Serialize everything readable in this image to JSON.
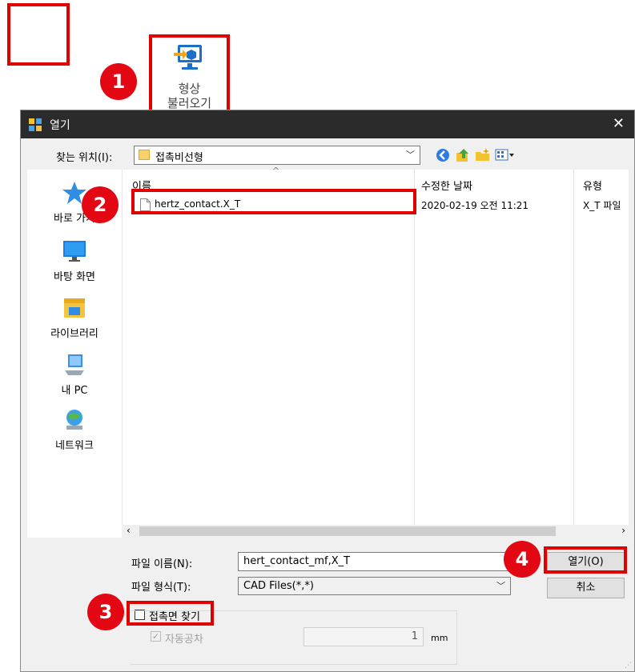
{
  "toolbar": {
    "shape_import_label_line1": "형상",
    "shape_import_label_line2": "불러오기",
    "shape_import_icon": "monitor-import-icon"
  },
  "steps": {
    "s1": "1",
    "s2": "2",
    "s3": "3",
    "s4": "4"
  },
  "dialog": {
    "title": "열기",
    "close_glyph": "✕",
    "look_in_label": "찾는 위치(I):",
    "look_in_value": "접촉비선형",
    "nav_icons": [
      "back-icon",
      "up-folder-icon",
      "new-folder-icon",
      "view-menu-icon"
    ],
    "places": [
      {
        "label": "바로 가기",
        "icon": "star-icon"
      },
      {
        "label": "바탕 화면",
        "icon": "desktop-icon"
      },
      {
        "label": "라이브러리",
        "icon": "library-icon"
      },
      {
        "label": "내 PC",
        "icon": "computer-icon"
      },
      {
        "label": "네트워크",
        "icon": "network-icon"
      }
    ],
    "columns": {
      "name": "이름",
      "date": "수정한 날짜",
      "type": "유형"
    },
    "files": [
      {
        "name": "hertz_contact.X_T",
        "date": "2020-02-19 오전 11:21",
        "type": "X_T 파일"
      }
    ],
    "filename_label": "파일 이름(N):",
    "filename_value": "hert_contact_mf,X_T",
    "filetype_label": "파일 형식(T):",
    "filetype_value": "CAD Files(*,*)",
    "open_button": "열기(O)",
    "cancel_button": "취소",
    "find_contact_label": "접촉면 찾기",
    "find_contact_checked": false,
    "auto_tolerance_label": "자동공차",
    "auto_tolerance_checked": true,
    "tolerance_value": "1",
    "tolerance_unit": "mm"
  },
  "colors": {
    "highlight": "#e00000",
    "badge": "#e30613",
    "titlebar": "#2b2b2b"
  }
}
